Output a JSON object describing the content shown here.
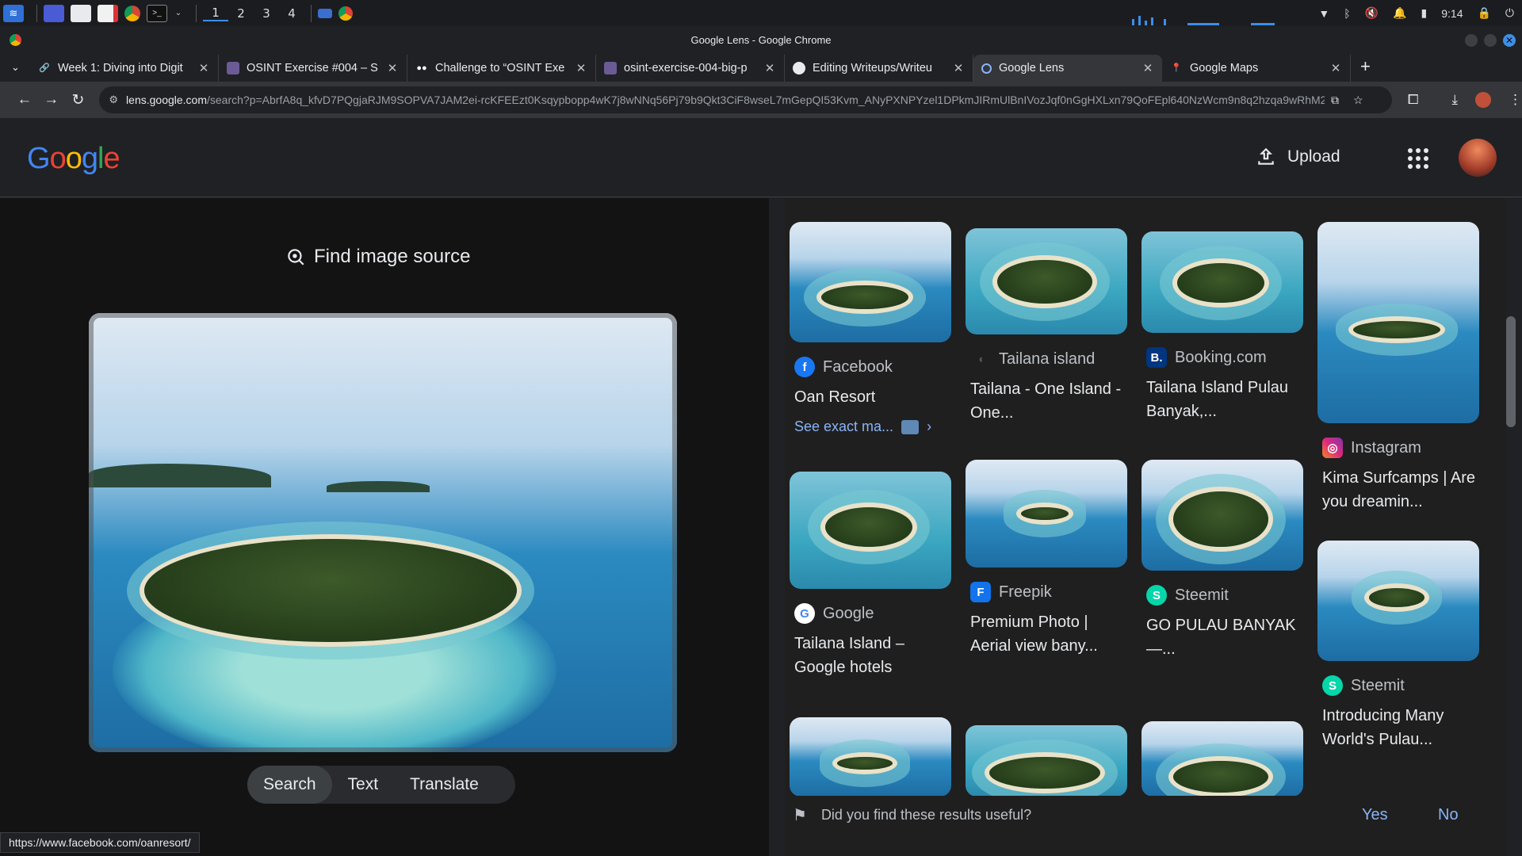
{
  "taskbar": {
    "workspaces": [
      "1",
      "2",
      "3",
      "4"
    ],
    "clock": "9:14"
  },
  "window": {
    "title": "Google Lens - Google Chrome"
  },
  "tabs": [
    {
      "label": "Week 1: Diving into Digit",
      "icon": "link-icon"
    },
    {
      "label": "OSINT Exercise #004 – S",
      "icon": "osint-icon"
    },
    {
      "label": "Challenge to “OSINT Exe",
      "icon": "medium-icon"
    },
    {
      "label": "osint-exercise-004-big-p",
      "icon": "osint-icon"
    },
    {
      "label": "Editing Writeups/Writeu",
      "icon": "github-icon"
    },
    {
      "label": "Google Lens",
      "icon": "lens-icon"
    },
    {
      "label": "Google Maps",
      "icon": "maps-icon"
    }
  ],
  "address": {
    "host": "lens.google.com",
    "path": "/search?p=AbrfA8q_kfvD7PQgjaRJM9SOPVA7JAM2ei-rcKFEEzt0Ksqypbopp4wK7j8wNNq56Pj79b9Qkt3CiF8wseL7mGepQI53Kvm_ANyPXNPYzel1DPkmJIRmUlBnIVozJqf0nGgHXLxn79QoFEpl640NzWcm9n8q2hzqa9wRhM2Y..."
  },
  "header": {
    "logo": "Google",
    "upload_label": "Upload"
  },
  "lens": {
    "find_source": "Find image source",
    "modes": [
      "Search",
      "Text",
      "Translate"
    ],
    "active_mode": "Search"
  },
  "results": [
    {
      "source": "Facebook",
      "source_icon": "facebook-icon",
      "title": "Oan Resort",
      "see_exact": "See exact ma..."
    },
    {
      "source": "Tailana island",
      "source_icon": "tailana-icon",
      "title": "Tailana - One Island - One..."
    },
    {
      "source": "Booking.com",
      "source_icon": "booking-icon",
      "title": "Tailana Island Pulau Banyak,..."
    },
    {
      "source": "Instagram",
      "source_icon": "instagram-icon",
      "title": "Kima Surfcamps | Are you dreamin..."
    },
    {
      "source": "Google",
      "source_icon": "google-icon",
      "title": "Tailana Island – Google hotels"
    },
    {
      "source": "Freepik",
      "source_icon": "freepik-icon",
      "title": "Premium Photo | Aerial view bany..."
    },
    {
      "source": "Steemit",
      "source_icon": "steemit-icon",
      "title": "GO PULAU BANYAK —..."
    },
    {
      "source": "Steemit",
      "source_icon": "steemit-icon",
      "title": "Introducing Many World's Pulau..."
    }
  ],
  "feedback": {
    "question": "Did you find these results useful?",
    "yes": "Yes",
    "no": "No"
  },
  "status_url": "https://www.facebook.com/oanresort/",
  "colors": {
    "accent": "#8ab4f8",
    "page_bg": "#202124",
    "facebook": "#1877f2",
    "booking": "#003580",
    "freepik": "#1273eb",
    "steemit": "#06d6a9"
  }
}
